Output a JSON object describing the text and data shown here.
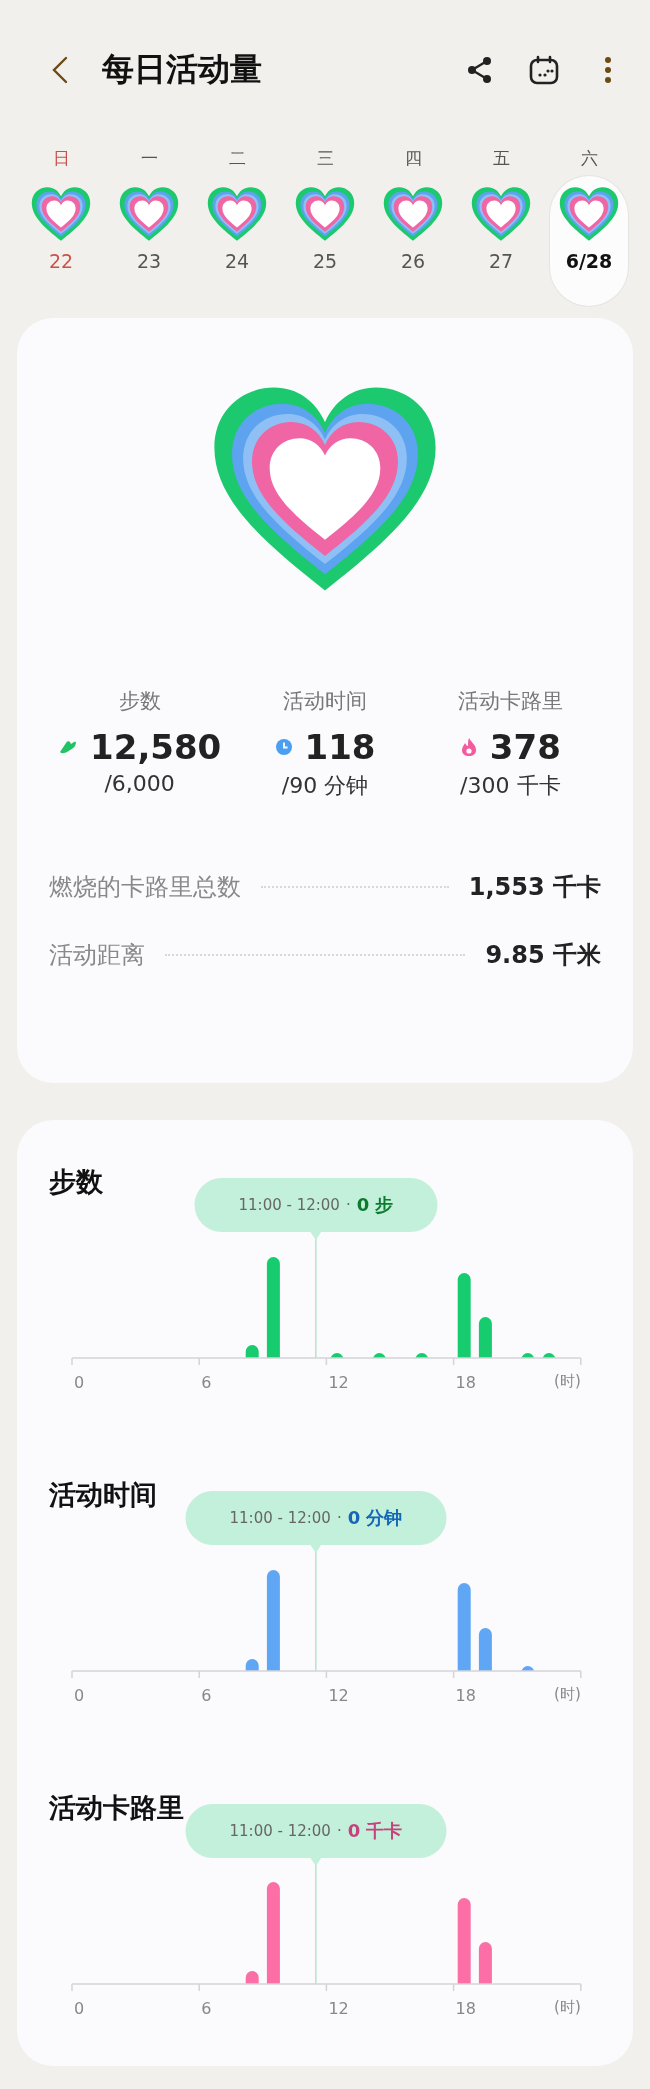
{
  "header": {
    "title": "每日活动量"
  },
  "week": [
    {
      "weekday": "日",
      "date": "22",
      "kind": "sunday",
      "selected": false
    },
    {
      "weekday": "一",
      "date": "23",
      "kind": "weekday",
      "selected": false
    },
    {
      "weekday": "二",
      "date": "24",
      "kind": "weekday",
      "selected": false
    },
    {
      "weekday": "三",
      "date": "25",
      "kind": "weekday",
      "selected": false
    },
    {
      "weekday": "四",
      "date": "26",
      "kind": "weekday",
      "selected": false
    },
    {
      "weekday": "五",
      "date": "27",
      "kind": "weekday",
      "selected": false
    },
    {
      "weekday": "六",
      "date": "6/28",
      "kind": "weekday",
      "selected": true
    }
  ],
  "summary": {
    "stats": [
      {
        "kind": "steps",
        "label": "步数",
        "value": "12,580",
        "goal": "/6,000"
      },
      {
        "kind": "time",
        "label": "活动时间",
        "value": "118",
        "goal": "/90 分钟"
      },
      {
        "kind": "calories",
        "label": "活动卡路里",
        "value": "378",
        "goal": "/300 千卡"
      }
    ],
    "totals": [
      {
        "label": "燃烧的卡路里总数",
        "value": "1,553 千卡"
      },
      {
        "label": "活动距离",
        "value": "9.85 千米"
      }
    ]
  },
  "charts": [
    {
      "kind": "steps",
      "title": "步数",
      "tooltip": {
        "range": "11:00 - 12:00",
        "separator": "·",
        "value": "0 步"
      },
      "axis_labels": [
        "0",
        "6",
        "12",
        "18",
        "(时)"
      ]
    },
    {
      "kind": "time",
      "title": "活动时间",
      "tooltip": {
        "range": "11:00 - 12:00",
        "separator": "·",
        "value": "0 分钟"
      },
      "axis_labels": [
        "0",
        "6",
        "12",
        "18",
        "(时)"
      ]
    },
    {
      "kind": "calories",
      "title": "活动卡路里",
      "tooltip": {
        "range": "11:00 - 12:00",
        "separator": "·",
        "value": "0 千卡"
      },
      "axis_labels": [
        "0",
        "6",
        "12",
        "18",
        "(时)"
      ]
    }
  ]
}
